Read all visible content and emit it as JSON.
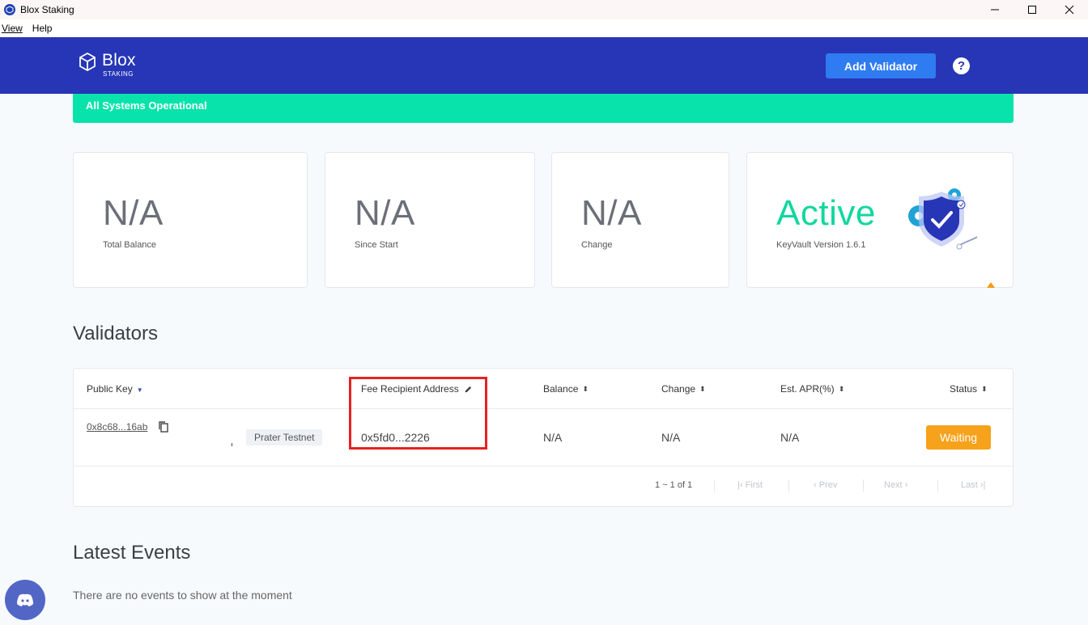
{
  "window": {
    "title": "Blox Staking"
  },
  "menu": {
    "view": "View",
    "help": "Help"
  },
  "header": {
    "brand": "Blox",
    "brand_sub": "STAKING",
    "add_validator_label": "Add Validator",
    "help_glyph": "?"
  },
  "banner": {
    "text": "All Systems Operational"
  },
  "stats": [
    {
      "value": "N/A",
      "label": "Total Balance"
    },
    {
      "value": "N/A",
      "label": "Since Start"
    },
    {
      "value": "N/A",
      "label": "Change"
    },
    {
      "value": "Active",
      "label": "KeyVault Version 1.6.1"
    }
  ],
  "validators": {
    "title": "Validators",
    "columns": {
      "public_key": "Public Key",
      "fee_recipient": "Fee Recipient Address",
      "balance": "Balance",
      "change": "Change",
      "apr": "Est. APR(%)",
      "status": "Status"
    },
    "rows": [
      {
        "public_key": "0x8c68...16ab",
        "network": "Prater Testnet",
        "fee_recipient": "0x5fd0...2226",
        "balance": "N/A",
        "change": "N/A",
        "apr": "N/A",
        "status": "Waiting"
      }
    ],
    "pagination": {
      "info": "1 ~ 1 of 1",
      "first": "First",
      "prev": "Prev",
      "next": "Next",
      "last": "Last"
    }
  },
  "events": {
    "title": "Latest Events",
    "empty_text": "There are no events to show at the moment"
  },
  "colors": {
    "header_bg": "#2636b6",
    "accent_button": "#2f7bf2",
    "banner_green": "#07e3aa",
    "active_green": "#11d79e",
    "status_orange": "#f7a21b",
    "highlight_red": "#e52222"
  },
  "icons": {
    "help": "question-circle-icon",
    "copy": "copy-icon",
    "edit": "pencil-icon",
    "discord": "discord-icon"
  }
}
